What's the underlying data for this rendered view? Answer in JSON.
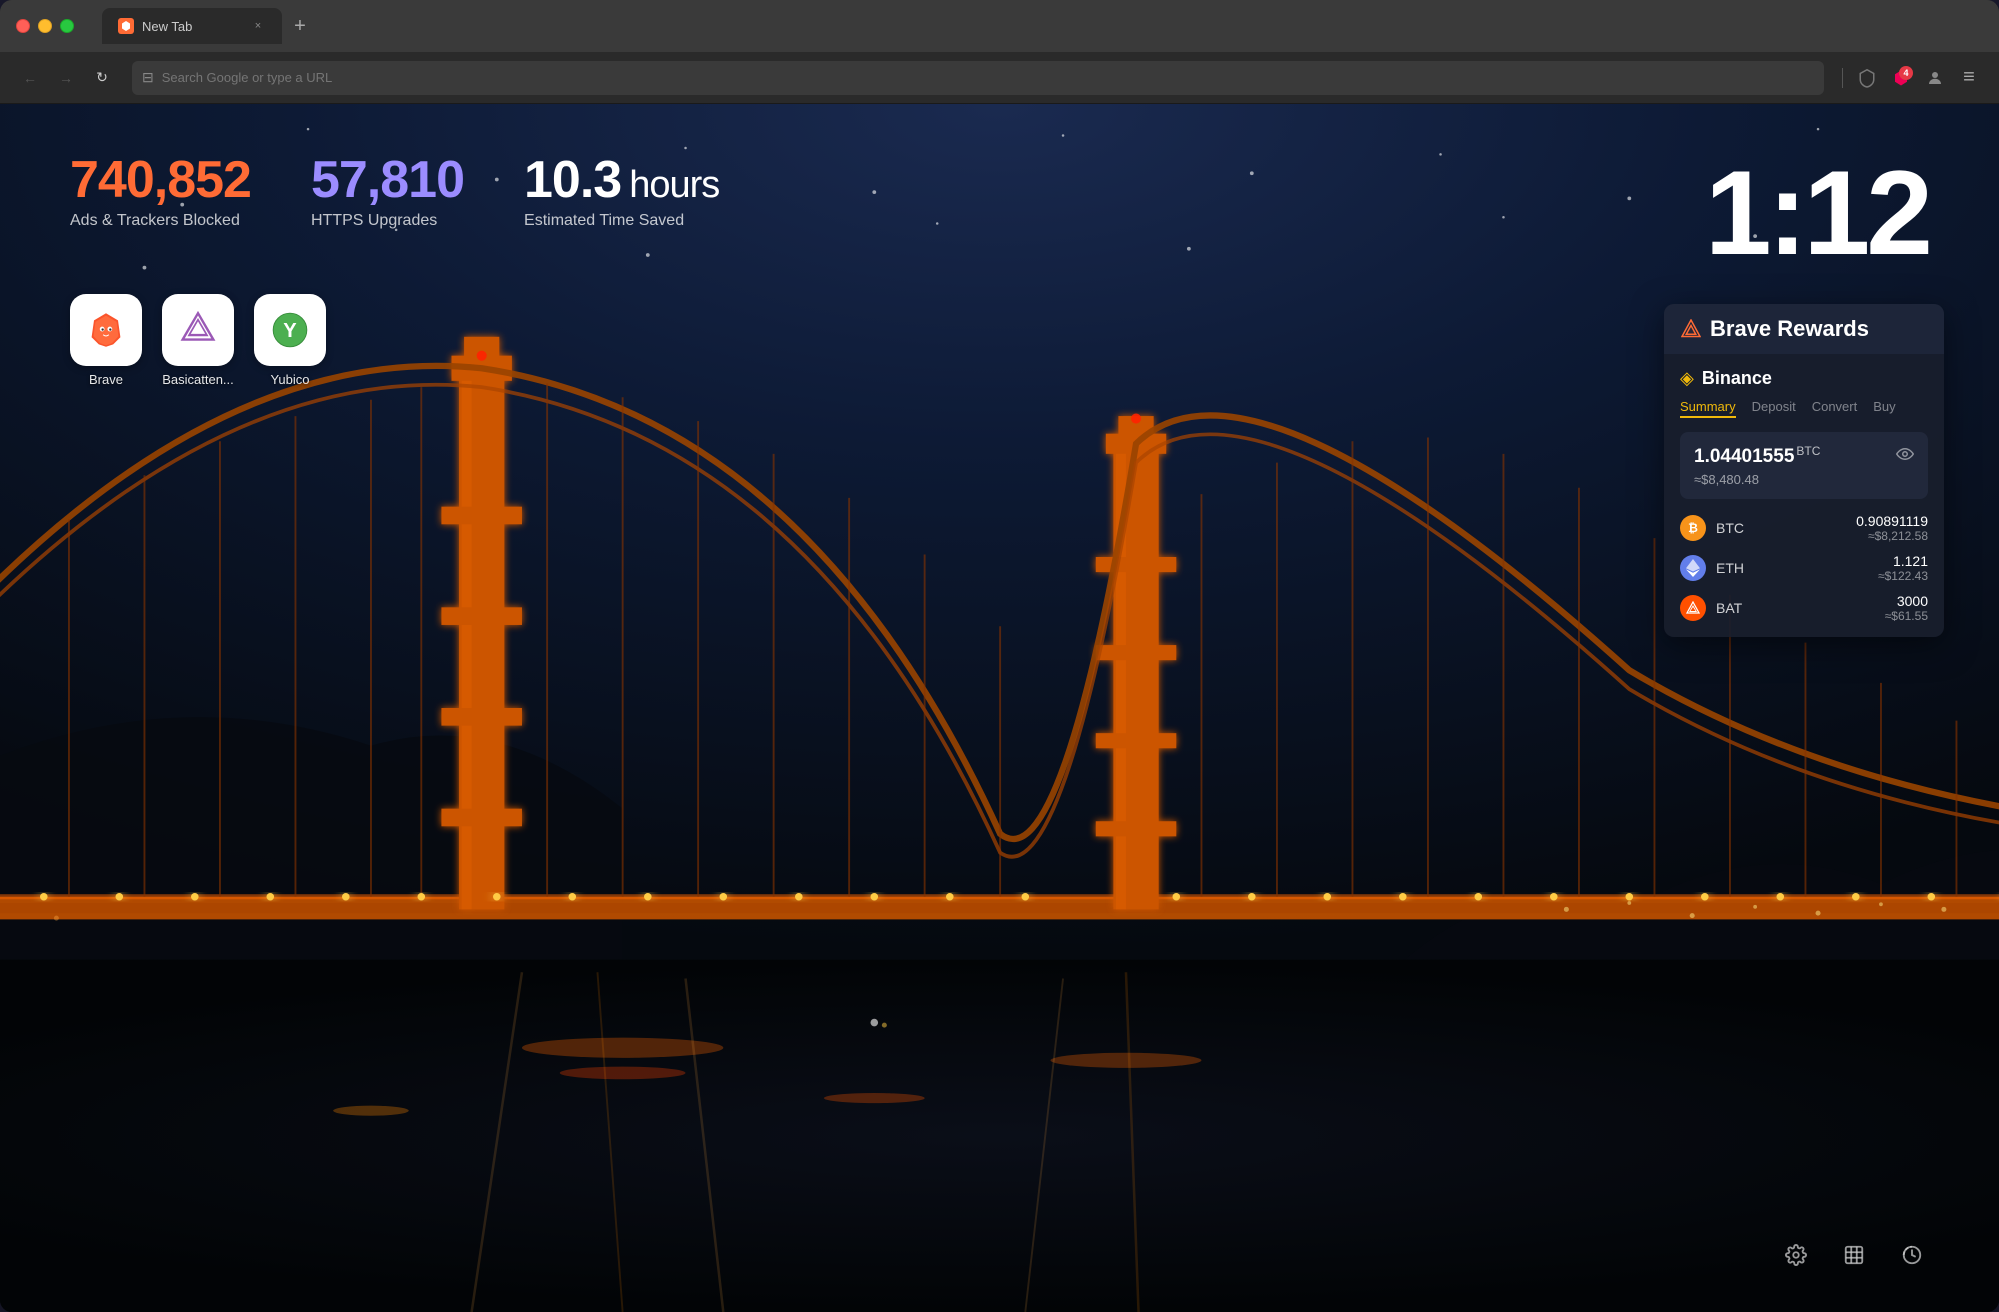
{
  "browser": {
    "tab": {
      "title": "New Tab",
      "close_label": "×"
    },
    "new_tab_label": "+",
    "toolbar": {
      "back_icon": "←",
      "forward_icon": "→",
      "reload_icon": "↻",
      "search_placeholder": "Search Google or type a URL",
      "bookmark_icon": "⊟",
      "shield_icon": "🛡",
      "reward_badge": "4",
      "profile_icon": "👤",
      "menu_icon": "≡"
    }
  },
  "stats": {
    "ads_blocked": {
      "value": "740,852",
      "label": "Ads & Trackers Blocked"
    },
    "https_upgrades": {
      "value": "57,810",
      "label": "HTTPS Upgrades"
    },
    "time_saved": {
      "value": "10.3",
      "unit": "hours",
      "label": "Estimated Time Saved"
    }
  },
  "clock": {
    "time": "1:12"
  },
  "app_icons": [
    {
      "name": "Brave",
      "label": "Brave"
    },
    {
      "name": "BasicAttention",
      "label": "Basicatten..."
    },
    {
      "name": "Yubico",
      "label": "Yubico"
    }
  ],
  "rewards_widget": {
    "title": "Brave Rewards",
    "binance": {
      "name": "Binance",
      "tabs": [
        "Summary",
        "Deposit",
        "Convert",
        "Buy"
      ],
      "active_tab": "Summary",
      "balance": {
        "amount": "1.04401555",
        "currency": "BTC",
        "usd": "≈$8,480.48"
      },
      "coins": [
        {
          "symbol": "BTC",
          "amount": "0.90891119",
          "usd": "≈$8,212.58"
        },
        {
          "symbol": "ETH",
          "amount": "1.121",
          "usd": "≈$122.43"
        },
        {
          "symbol": "BAT",
          "amount": "3000",
          "usd": "≈$61.55"
        }
      ]
    }
  },
  "bottom_icons": {
    "settings": "⚙",
    "bookmarks": "⊟",
    "history": "⟳"
  },
  "colors": {
    "orange": "#ff6b35",
    "purple": "#9b8cff",
    "binance_yellow": "#f0b90b",
    "btc_orange": "#f7931a",
    "eth_blue": "#627eea",
    "bat_orange": "#ff5000"
  }
}
